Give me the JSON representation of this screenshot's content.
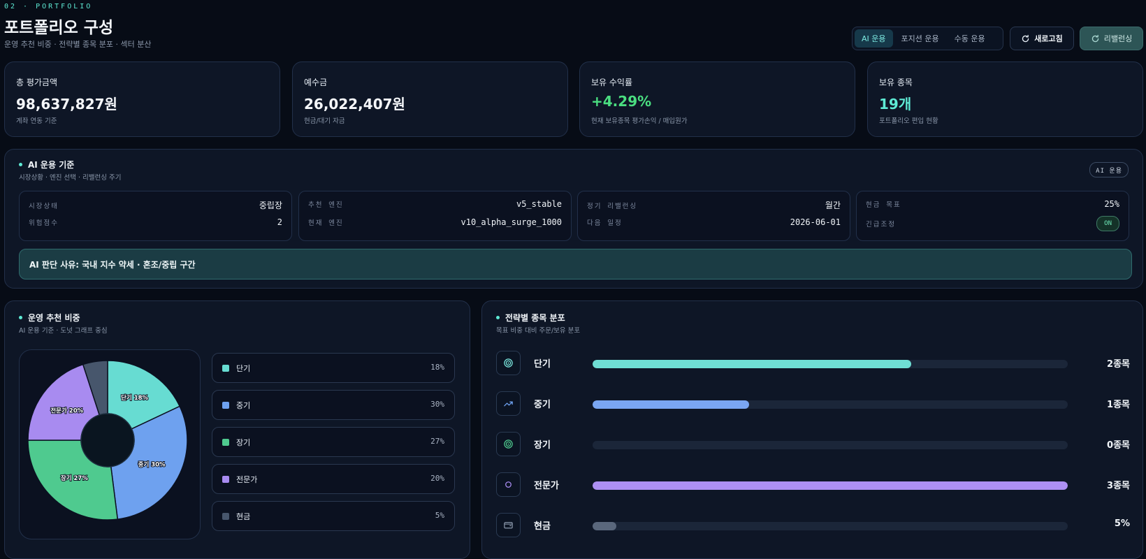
{
  "header": {
    "eyebrow": "02 · PORTFOLIO",
    "title": "포트폴리오 구성",
    "subtitle": "운영 추천 비중 · 전략별 종목 분포 · 섹터 분산"
  },
  "mode_tabs": [
    {
      "label": "AI 운용",
      "active": true
    },
    {
      "label": "포지션 운용",
      "active": false
    },
    {
      "label": "수동 운용",
      "active": false
    }
  ],
  "actions": {
    "refresh": "새로고침",
    "rebalance": "리밸런싱"
  },
  "kpis": [
    {
      "label": "총 평가금액",
      "value": "98,637,827원",
      "note": "계좌 연동 기준",
      "color": "#f5f7fa"
    },
    {
      "label": "예수금",
      "value": "26,022,407원",
      "note": "현금/대기 자금",
      "color": "#f5f7fa"
    },
    {
      "label": "보유 수익률",
      "value": "+4.29%",
      "note": "현재 보유종목 평가손익 / 매입원가",
      "color": "#4ade80"
    },
    {
      "label": "보유 종목",
      "value": "19개",
      "note": "포트폴리오 편입 현황",
      "color": "#5eead4"
    }
  ],
  "ai_criteria": {
    "title": "AI 운용 기준",
    "subtitle": "시장상황 · 엔진 선택 · 리밸런싱 주기",
    "tag": "AI 운용",
    "stats": [
      [
        {
          "k": "시장상태",
          "v": "중립장"
        },
        {
          "k": "위험점수",
          "v": "2"
        }
      ],
      [
        {
          "k": "추천 엔진",
          "v": "v5_stable"
        },
        {
          "k": "현재 엔진",
          "v": "v10_alpha_surge_1000"
        }
      ],
      [
        {
          "k": "정기 리밸런싱",
          "v": "월간"
        },
        {
          "k": "다음 일정",
          "v": "2026-06-01"
        }
      ],
      [
        {
          "k": "현금 목표",
          "v": "25%"
        },
        {
          "k": "긴급조정",
          "v": "ON"
        }
      ]
    ],
    "reason": "AI 판단 사유: 국내 지수 약세 · 혼조/중립 구간"
  },
  "weights": {
    "title": "운영 추천 비중",
    "subtitle": "AI 운용 기준 · 도넛 그래프 중심",
    "items": [
      {
        "name": "단기",
        "pct": "18%",
        "value": 18,
        "color": "#67dcd2",
        "slice_label": "단기 18%"
      },
      {
        "name": "중기",
        "pct": "30%",
        "value": 30,
        "color": "#6ea1ef",
        "slice_label": "중기 30%"
      },
      {
        "name": "장기",
        "pct": "27%",
        "value": 27,
        "color": "#4fca8f",
        "slice_label": "장기 27%"
      },
      {
        "name": "전문가",
        "pct": "20%",
        "value": 20,
        "color": "#a88bf0",
        "slice_label": "전문가 20%"
      },
      {
        "name": "현금",
        "pct": "5%",
        "value": 5,
        "color": "#47566c",
        "slice_label": ""
      }
    ]
  },
  "distribution": {
    "title": "전략별 종목 분포",
    "subtitle": "목표 비중 대비 주문/보유 분포",
    "rows": [
      {
        "name": "단기",
        "count": "2종목",
        "fill": 0.67,
        "color": "#6fded4",
        "icon": "target-icon",
        "icon_color": "#7ce9e0"
      },
      {
        "name": "중기",
        "count": "1종목",
        "fill": 0.33,
        "color": "#7aa6f2",
        "icon": "trend-up-icon",
        "icon_color": "#6ea1ef"
      },
      {
        "name": "장기",
        "count": "0종목",
        "fill": 0.0,
        "color": "#4fca8f",
        "icon": "target-icon",
        "icon_color": "#4fca8f"
      },
      {
        "name": "전문가",
        "count": "3종목",
        "fill": 1.0,
        "color": "#ad90f3",
        "icon": "circle-icon",
        "icon_color": "#a88bf0"
      },
      {
        "name": "현금",
        "count": "5%",
        "fill": 0.05,
        "color": "#5a677c",
        "icon": "wallet-icon",
        "icon_color": "#8b98ab"
      }
    ]
  }
}
